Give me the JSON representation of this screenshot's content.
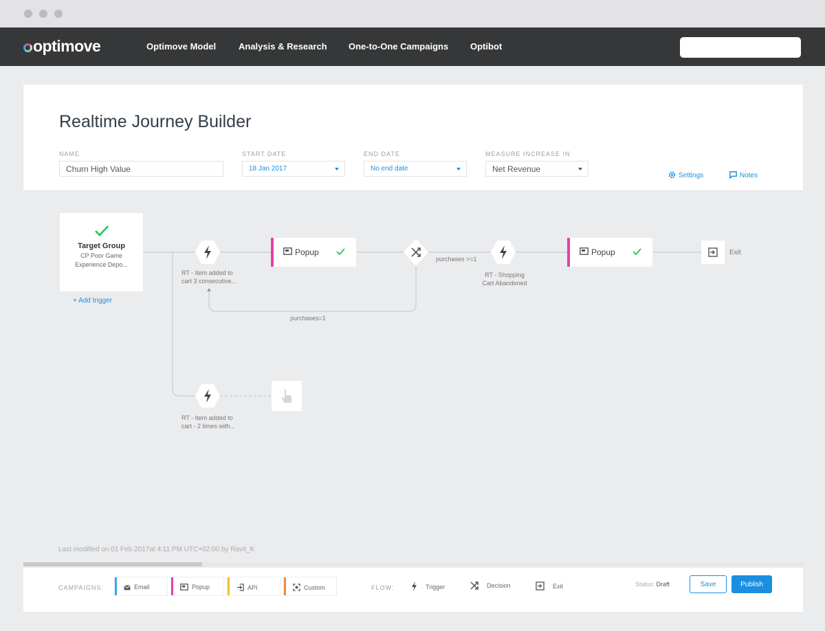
{
  "nav": {
    "logo": "optimove",
    "items": [
      "Optimove Model",
      "Analysis & Research",
      "One-to-One Campaigns",
      "Optibot"
    ]
  },
  "header": {
    "title": "Realtime Journey Builder",
    "name_label": "NAME",
    "name_value": "Churn High Value",
    "start_label": "START DATE",
    "start_value": "18 Jan 2017",
    "end_label": "END DATE",
    "end_value": "No end date",
    "measure_label": "MEASURE INCREASE IN",
    "measure_value": "Net Revenue",
    "settings": "Settings",
    "notes": "Notes"
  },
  "journey": {
    "target_group_title": "Target Group",
    "target_group_sub1": "CP Poor Game",
    "target_group_sub2": "Experience Depo...",
    "add_trigger": "+ Add trigger",
    "trigger1_line1": "RT - Item added to",
    "trigger1_line2": "cart 3 consecutive...",
    "popup1": "Popup",
    "decision_edge": "purchases >=1",
    "loop_edge": "purchases=1",
    "trigger2_line1": "RT - Shopping",
    "trigger2_line2": "Cart Abandoned",
    "popup2": "Popup",
    "exit": "Exit",
    "trigger3_line1": "RT - Item added to",
    "trigger3_line2": "cart - 2 times with...",
    "last_modified": "Last modified on 01 Feb 2017at 4:11 PM UTC+02:00 by Ravit_K"
  },
  "bottom": {
    "campaigns_label": "CAMPAIGNS:",
    "campaigns": [
      {
        "label": "Email",
        "color": "#3aa9e8"
      },
      {
        "label": "Popup",
        "color": "#e640a8"
      },
      {
        "label": "API",
        "color": "#f2c12e"
      },
      {
        "label": "Custom",
        "color": "#f08a3c"
      }
    ],
    "flow_label": "FLOW:",
    "flow": [
      "Trigger",
      "Decision",
      "Exit"
    ],
    "status_label": "Status:",
    "status_value": "Draft",
    "save": "Save",
    "publish": "Publish"
  },
  "colors": {
    "accent": "#1a8fe0",
    "popup": "#e640a8",
    "check": "#2cbf5c",
    "nav_bg": "#363738"
  }
}
